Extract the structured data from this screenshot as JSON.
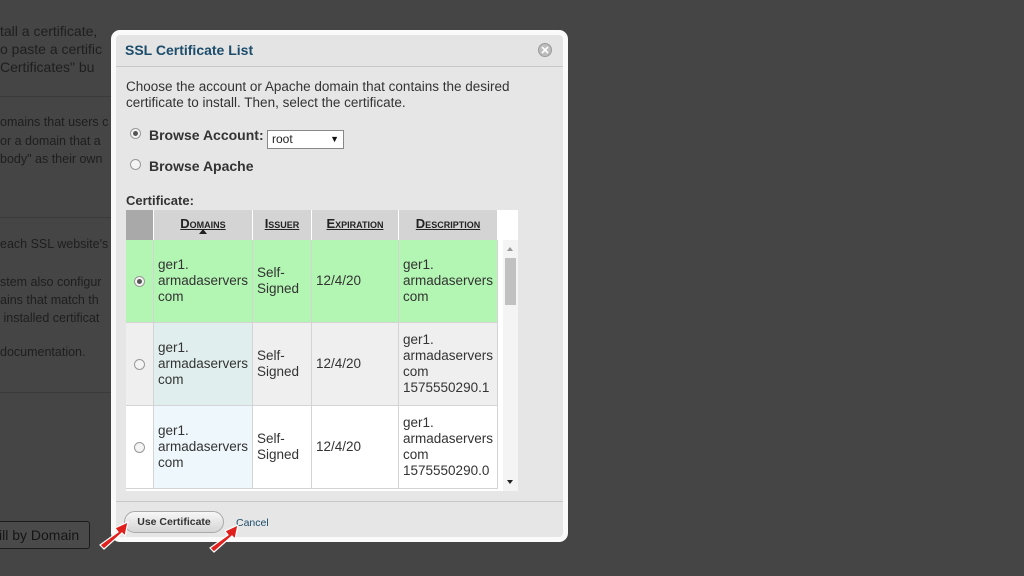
{
  "background": {
    "para1": "tall a certificate,\no paste a certific\nCertificates\" bu",
    "para2": "omains that users c\nor a domain that a\nbody\" as their own",
    "para3": "each SSL website's",
    "para4": "stem also configur\nains that match th\n installed certificat",
    "para5": " documentation.",
    "button_label": "ill by Domain"
  },
  "dialog": {
    "title": "SSL Certificate List",
    "intro": "Choose the account or Apache domain that contains the desired certificate to install. Then, select the certificate.",
    "browse_account_label": "Browse Account:",
    "account_select_value": "root",
    "browse_apache_label": "Browse Apache",
    "certificate_label": "Certificate:",
    "columns": [
      "Domains",
      "Issuer",
      "Expiration",
      "Description"
    ],
    "rows": [
      {
        "domain": "ger1.\narmadaservers\ncom",
        "issuer": "Self-\nSigned",
        "expiration": "12/4/20",
        "description": "ger1.\narmadaservers\ncom",
        "selected": true
      },
      {
        "domain": "ger1.\narmadaservers\ncom",
        "issuer": "Self-\nSigned",
        "expiration": "12/4/20",
        "description": "ger1.\narmadaservers\ncom\n1575550290.1",
        "selected": false
      },
      {
        "domain": "ger1.\narmadaservers\ncom",
        "issuer": "Self-\nSigned",
        "expiration": "12/4/20",
        "description": "ger1.\narmadaservers\ncom\n1575550290.0",
        "selected": false
      }
    ],
    "use_button": "Use Certificate",
    "cancel_link": "Cancel"
  },
  "colors": {
    "title": "#1b4d6b",
    "selected_row": "#b3f5b3",
    "pointer": "#e0201c"
  }
}
